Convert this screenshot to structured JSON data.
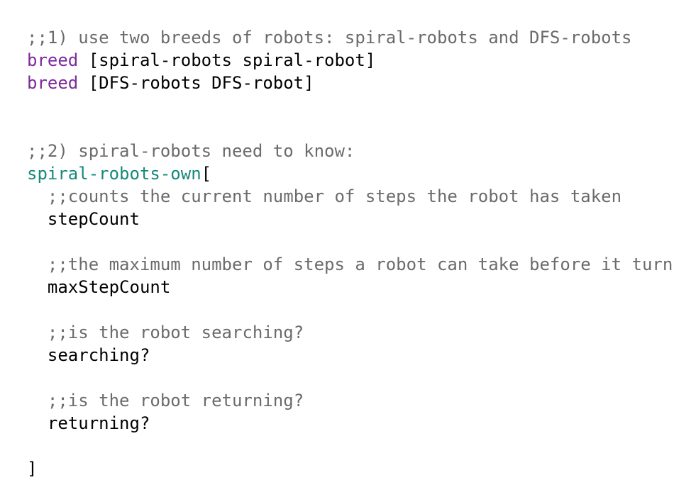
{
  "editor": {
    "lines": [
      {
        "indent": "",
        "tokens": [
          {
            "text": ";;1) use two breeds of robots: spiral-robots and DFS-robots",
            "kind": "comment"
          }
        ]
      },
      {
        "indent": "",
        "tokens": [
          {
            "text": "breed",
            "kind": "keyword"
          },
          {
            "text": " [spiral-robots spiral-robot]",
            "kind": "plain"
          }
        ]
      },
      {
        "indent": "",
        "tokens": [
          {
            "text": "breed",
            "kind": "keyword"
          },
          {
            "text": " [DFS-robots DFS-robot]",
            "kind": "plain"
          }
        ]
      },
      {
        "indent": "",
        "tokens": []
      },
      {
        "indent": "",
        "tokens": []
      },
      {
        "indent": "",
        "tokens": [
          {
            "text": ";;2) spiral-robots need to know:",
            "kind": "comment"
          }
        ]
      },
      {
        "indent": "",
        "tokens": [
          {
            "text": "spiral-robots-own",
            "kind": "owns"
          },
          {
            "text": "[",
            "kind": "plain"
          }
        ]
      },
      {
        "indent": "  ",
        "tokens": [
          {
            "text": ";;counts the current number of steps the robot has taken",
            "kind": "comment"
          }
        ]
      },
      {
        "indent": "  ",
        "tokens": [
          {
            "text": "stepCount",
            "kind": "plain"
          }
        ]
      },
      {
        "indent": "",
        "tokens": []
      },
      {
        "indent": "  ",
        "tokens": [
          {
            "text": ";;the maximum number of steps a robot can take before it turns",
            "kind": "comment"
          }
        ]
      },
      {
        "indent": "  ",
        "tokens": [
          {
            "text": "maxStepCount",
            "kind": "plain"
          }
        ]
      },
      {
        "indent": "",
        "tokens": []
      },
      {
        "indent": "  ",
        "tokens": [
          {
            "text": ";;is the robot searching?",
            "kind": "comment"
          }
        ]
      },
      {
        "indent": "  ",
        "tokens": [
          {
            "text": "searching?",
            "kind": "plain"
          }
        ]
      },
      {
        "indent": "",
        "tokens": []
      },
      {
        "indent": "  ",
        "tokens": [
          {
            "text": ";;is the robot returning?",
            "kind": "comment"
          }
        ]
      },
      {
        "indent": "  ",
        "tokens": [
          {
            "text": "returning?",
            "kind": "plain"
          }
        ]
      },
      {
        "indent": "",
        "tokens": []
      },
      {
        "indent": "",
        "tokens": [
          {
            "text": "]",
            "kind": "plain"
          }
        ]
      }
    ]
  },
  "colors": {
    "background": "#ffffff",
    "comment": "#6b6b6b",
    "keyword": "#7d2a9b",
    "owns": "#15897a",
    "plain": "#000000"
  }
}
